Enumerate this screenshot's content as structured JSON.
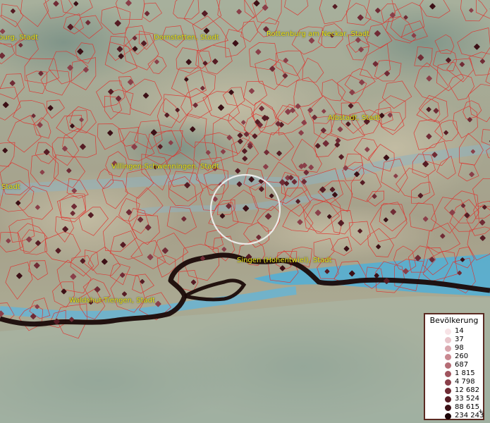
{
  "labels": {
    "rottenburg_partial": "burg, Stadt",
    "dornstetten": "Dornstetten, Stadt",
    "rottenburg_neckar": "Rottenburg am Neckar, Stadt",
    "albstadt": "Albstadt, Stadt",
    "villingen": "Villingen-Schwenningen, Stadt",
    "left_partial": "Stadt",
    "singen": "Singen (Hohentwiel), Stadt",
    "waldshut": "Waldshut-Tiengen, Stadt"
  },
  "legend": {
    "title": "Bevölkerung",
    "plus": "+",
    "items": [
      {
        "value": "14",
        "color": "#f7e3e6"
      },
      {
        "value": "37",
        "color": "#e9c6cb"
      },
      {
        "value": "98",
        "color": "#d9a6ad"
      },
      {
        "value": "260",
        "color": "#c98890"
      },
      {
        "value": "687",
        "color": "#b56c75"
      },
      {
        "value": "1 815",
        "color": "#a0545e"
      },
      {
        "value": "4 798",
        "color": "#8a3f49"
      },
      {
        "value": "12 682",
        "color": "#702b35"
      },
      {
        "value": "33 524",
        "color": "#561c24"
      },
      {
        "value": "88 615",
        "color": "#3c1016"
      },
      {
        "value": "234 243",
        "color": "#1c0508"
      }
    ]
  },
  "colors": {
    "borders": "#e0302c",
    "lake": "#4ab0dc",
    "label": "#e8e21a",
    "national_border": "#1a0a08"
  }
}
